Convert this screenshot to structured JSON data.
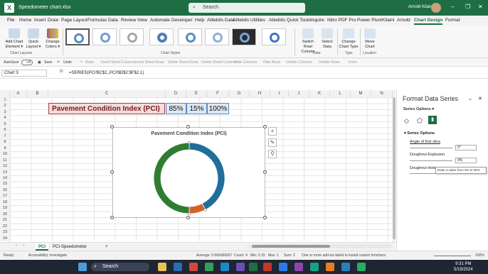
{
  "window": {
    "filename": "Speedometer chart.xlsx",
    "search_placeholder": "Search",
    "user_name": "Arnold Kilaini",
    "minimize": "–",
    "maximize": "❐",
    "close": "✕"
  },
  "menu": {
    "items": [
      "File",
      "Home",
      "Insert",
      "Draw",
      "Page Layout",
      "Formulas",
      "Data",
      "Review",
      "View",
      "Automate",
      "Developer",
      "Help",
      "Ablebits Data",
      "Ablebits Utilities",
      "Ablebits Quick Tools",
      "Inquire",
      "Nitro PDF Pro",
      "Power Pivot",
      "Kilaini",
      "Arnold",
      "Chart Design",
      "Format"
    ],
    "active": "Chart Design"
  },
  "ribbon": {
    "add_chart_element": "Add Chart Element ▾",
    "quick_layout": "Quick Layout ▾",
    "change_colors": "Change Colors ▾",
    "chart_layouts_label": "Chart Layouts",
    "chart_styles_label": "Chart Styles",
    "switch_row_column": "Switch Row/ Column",
    "select_data": "Select Data",
    "data_label": "Data",
    "change_chart_type": "Change Chart Type",
    "type_label": "Type",
    "move_chart": "Move Chart",
    "location_label": "Location"
  },
  "qat": {
    "autosave": "AutoSave",
    "toggle": "Off",
    "save": "Save",
    "undo": "Undo",
    "redo": "Redo",
    "items": [
      "Insert Sheet Columns",
      "Insert Sheet Rows",
      "Delete Sheet Rows",
      "Delete Sheet Columns",
      "Hide Columns",
      "Hide Rows",
      "Unhide Columns",
      "Unhide Rows",
      "Form"
    ]
  },
  "formula_bar": {
    "name_box": "Chart 3",
    "fx": "fx",
    "formula": "=SERIES(PCI!$C$2,,PCI!$D$2:$F$2,1)"
  },
  "grid": {
    "columns": [
      "A",
      "B",
      "C",
      "D",
      "E",
      "F",
      "G",
      "H",
      "I",
      "J",
      "K",
      "L",
      "M",
      "N"
    ],
    "rows": [
      "1",
      "2",
      "3",
      "4",
      "5",
      "6",
      "7",
      "8",
      "9",
      "10",
      "11",
      "12",
      "13",
      "14",
      "15",
      "16",
      "17",
      "18",
      "19",
      "20",
      "21",
      "22",
      "23",
      "24"
    ]
  },
  "cells": {
    "title": "Pavement Condition Index (PCI)",
    "d2": "85%",
    "e2": "15%",
    "f2": "100%"
  },
  "chart": {
    "title": "Pavement Condition Index (PCI)",
    "plus_button": "+",
    "brush_button": "✎",
    "filter_button": "⚲"
  },
  "chart_data": {
    "type": "pie",
    "title": "Pavement Condition Index (PCI)",
    "variant": "doughnut",
    "categories": [
      "85%",
      "15%",
      "100%"
    ],
    "values": [
      85,
      15,
      100
    ],
    "colors": [
      "#1f6e9c",
      "#d4622a",
      "#2e7d32"
    ],
    "start_angle": 0
  },
  "format_panel": {
    "title": "Format Data Series",
    "options_label": "Series Options ▾",
    "section": "Series Options",
    "angle_label": "Angle of first slice",
    "angle_value": "0°",
    "explosion_label": "Doughnut Explosion",
    "explosion_value": "0%",
    "hole_label": "Doughnut Hole",
    "tooltip": "Enter a value from 0% to 90%"
  },
  "sheets": {
    "tabs": [
      "PCI",
      "PCI-Speedometer"
    ],
    "active": "PCI",
    "add": "+"
  },
  "status": {
    "ready": "Ready",
    "accessibility": "Accessibility: Investigate",
    "average": "Average: 0.666666667",
    "count": "Count: 4",
    "min": "Min: 0.15",
    "max": "Max: 1",
    "sum": "Sum: 2",
    "addins": "One or more add-ins failed to install custom functions.",
    "zoom": "100%"
  },
  "taskbar": {
    "search": "Search",
    "time": "9:31 PM",
    "date": "5/19/2024"
  }
}
